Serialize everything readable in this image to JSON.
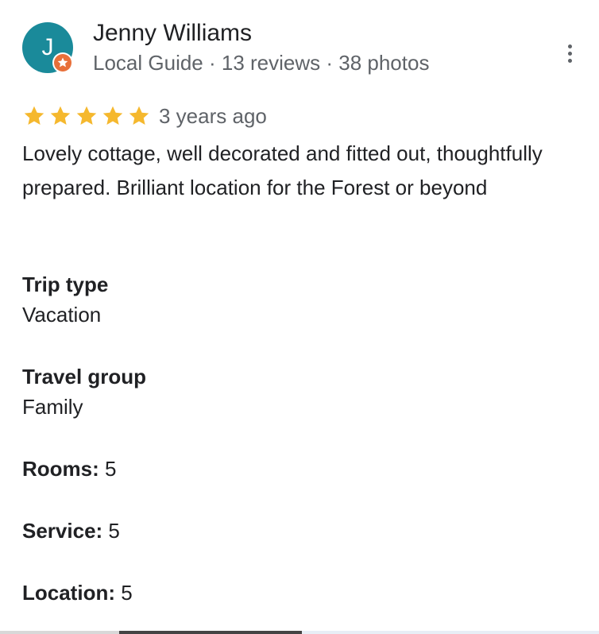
{
  "author": {
    "initial": "J",
    "name": "Jenny Williams",
    "meta": "Local Guide · 13 reviews · 38 photos",
    "avatar_color": "#1a8a9a",
    "badge_color": "#e8703a",
    "badge_icon": "local-guide-star-icon"
  },
  "menu": {
    "icon": "more-vert-icon"
  },
  "rating": {
    "stars": 5,
    "max_stars": 5,
    "star_color": "#f5b82e"
  },
  "review": {
    "date": "3 years ago",
    "text": "Lovely cottage, well decorated and fitted out, thoughtfully prepared. Brilliant location for the Forest or beyond"
  },
  "details": {
    "trip_type_label": "Trip type",
    "trip_type_value": "Vacation",
    "travel_group_label": "Travel group",
    "travel_group_value": "Family"
  },
  "ratings": {
    "rooms_label": "Rooms:",
    "rooms_value": "5",
    "service_label": "Service:",
    "service_value": "5",
    "location_label": "Location:",
    "location_value": "5"
  }
}
